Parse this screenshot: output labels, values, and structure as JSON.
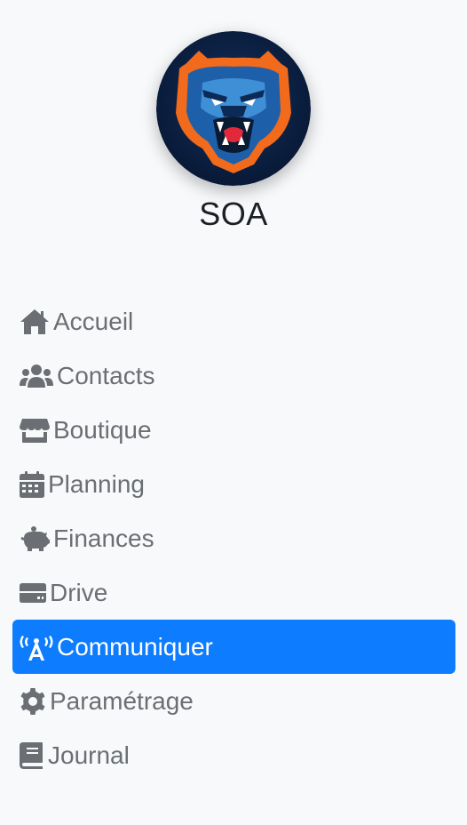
{
  "brand": {
    "name": "SOA",
    "logo": "bear-mascot-logo"
  },
  "colors": {
    "accent": "#0d7cff",
    "text": "#6b6e73",
    "background": "#f8f9fb"
  },
  "nav": {
    "items": [
      {
        "label": "Accueil",
        "icon": "home-icon"
      },
      {
        "label": "Contacts",
        "icon": "users-icon"
      },
      {
        "label": "Boutique",
        "icon": "store-icon"
      },
      {
        "label": "Planning",
        "icon": "calendar-icon"
      },
      {
        "label": "Finances",
        "icon": "piggy-bank-icon"
      },
      {
        "label": "Drive",
        "icon": "drive-icon"
      },
      {
        "label": "Communiquer",
        "icon": "broadcast-tower-icon",
        "active": true
      },
      {
        "label": "Paramétrage",
        "icon": "gear-icon"
      },
      {
        "label": "Journal",
        "icon": "book-icon"
      }
    ]
  }
}
